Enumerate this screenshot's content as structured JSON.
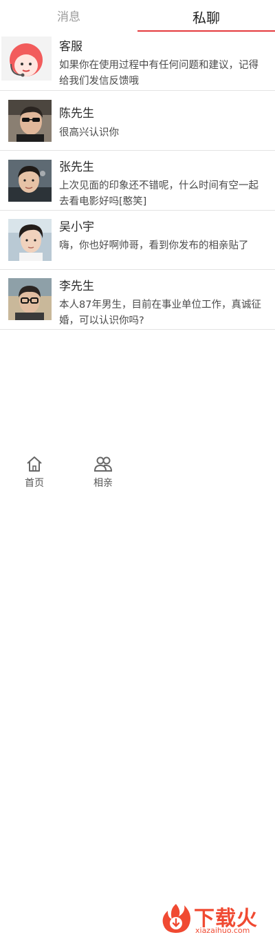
{
  "tabs": {
    "messages_label": "消息",
    "private_chat_label": "私聊",
    "active_tab": "私聊",
    "active_color": "#e4393c"
  },
  "conversations": [
    {
      "name": "客服",
      "preview": "如果你在使用过程中有任何问题和建议，记得给我们发信反馈哦",
      "avatar": "customer-service-avatar"
    },
    {
      "name": "陈先生",
      "preview": "很高兴认识你",
      "avatar": "user-photo-avatar"
    },
    {
      "name": "张先生",
      "preview": "上次见面的印象还不错呢，什么时间有空一起去看电影好吗[憨笑]",
      "avatar": "user-photo-avatar"
    },
    {
      "name": "吴小宇",
      "preview": "嗨，你也好啊帅哥，看到你发布的相亲贴了",
      "avatar": "user-photo-avatar"
    },
    {
      "name": "李先生",
      "preview": "本人87年男生，目前在事业单位工作，真诚征婚，可以认识你吗?",
      "avatar": "user-photo-avatar"
    }
  ],
  "bottom_nav": {
    "home_label": "首页",
    "match_label": "相亲"
  },
  "watermark": {
    "brand": "下载火",
    "domain": "xiazaihuo.com"
  }
}
